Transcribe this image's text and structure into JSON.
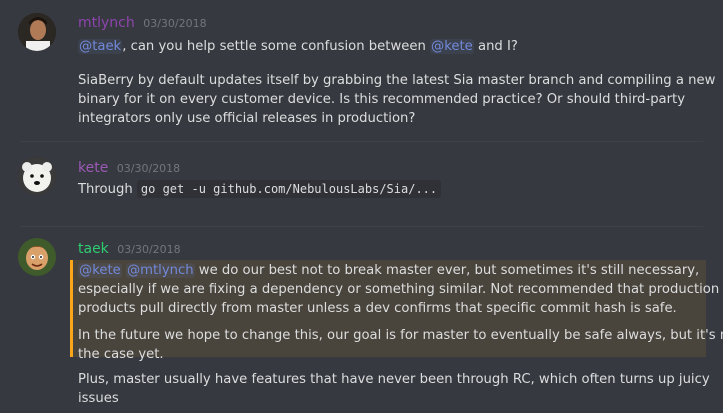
{
  "messages": {
    "m1": {
      "author": "mtlynch",
      "author_color": "#8e44ad",
      "timestamp": "03/30/2018",
      "line1_mention_a": "@taek",
      "line1_text_a": ", can you help settle some confusion between ",
      "line1_mention_b": "@kete",
      "line1_text_b": " and I?",
      "para1": "SiaBerry by default updates itself by grabbing the latest Sia master branch and compiling a new",
      "para2": "binary for it on every customer device. Is this recommended practice? Or should third-party",
      "para3": "integrators only use official releases in production?"
    },
    "m2": {
      "author": "kete",
      "author_color": "#9b59b6",
      "timestamp": "03/30/2018",
      "text": "Through ",
      "code": "go get -u github.com/NebulousLabs/Sia/..."
    },
    "m3": {
      "author": "taek",
      "author_color": "#2ecc71",
      "timestamp": "03/30/2018",
      "mention_a": "@kete",
      "mention_b": "@mtlynch",
      "hl_line1": " we do our best not to break master ever, but sometimes it's still necessary,",
      "hl_line2": "especially if we are fixing a dependency or something similar. Not recommended that production",
      "hl_line3": "products pull directly from master unless a dev confirms that specific commit hash is safe.",
      "hl_line4": "In the future we hope to change this, our goal is for master to eventually be safe always, but it's not",
      "hl_line5": "the case yet.",
      "line6": "Plus, master usually have features that have never been through RC, which often turns up juicy",
      "line7": "issues"
    }
  },
  "colors": {
    "background": "#36393f",
    "mention": "#7289da",
    "highlight_bar": "#faa61a",
    "highlight_bg": "#49443c"
  }
}
